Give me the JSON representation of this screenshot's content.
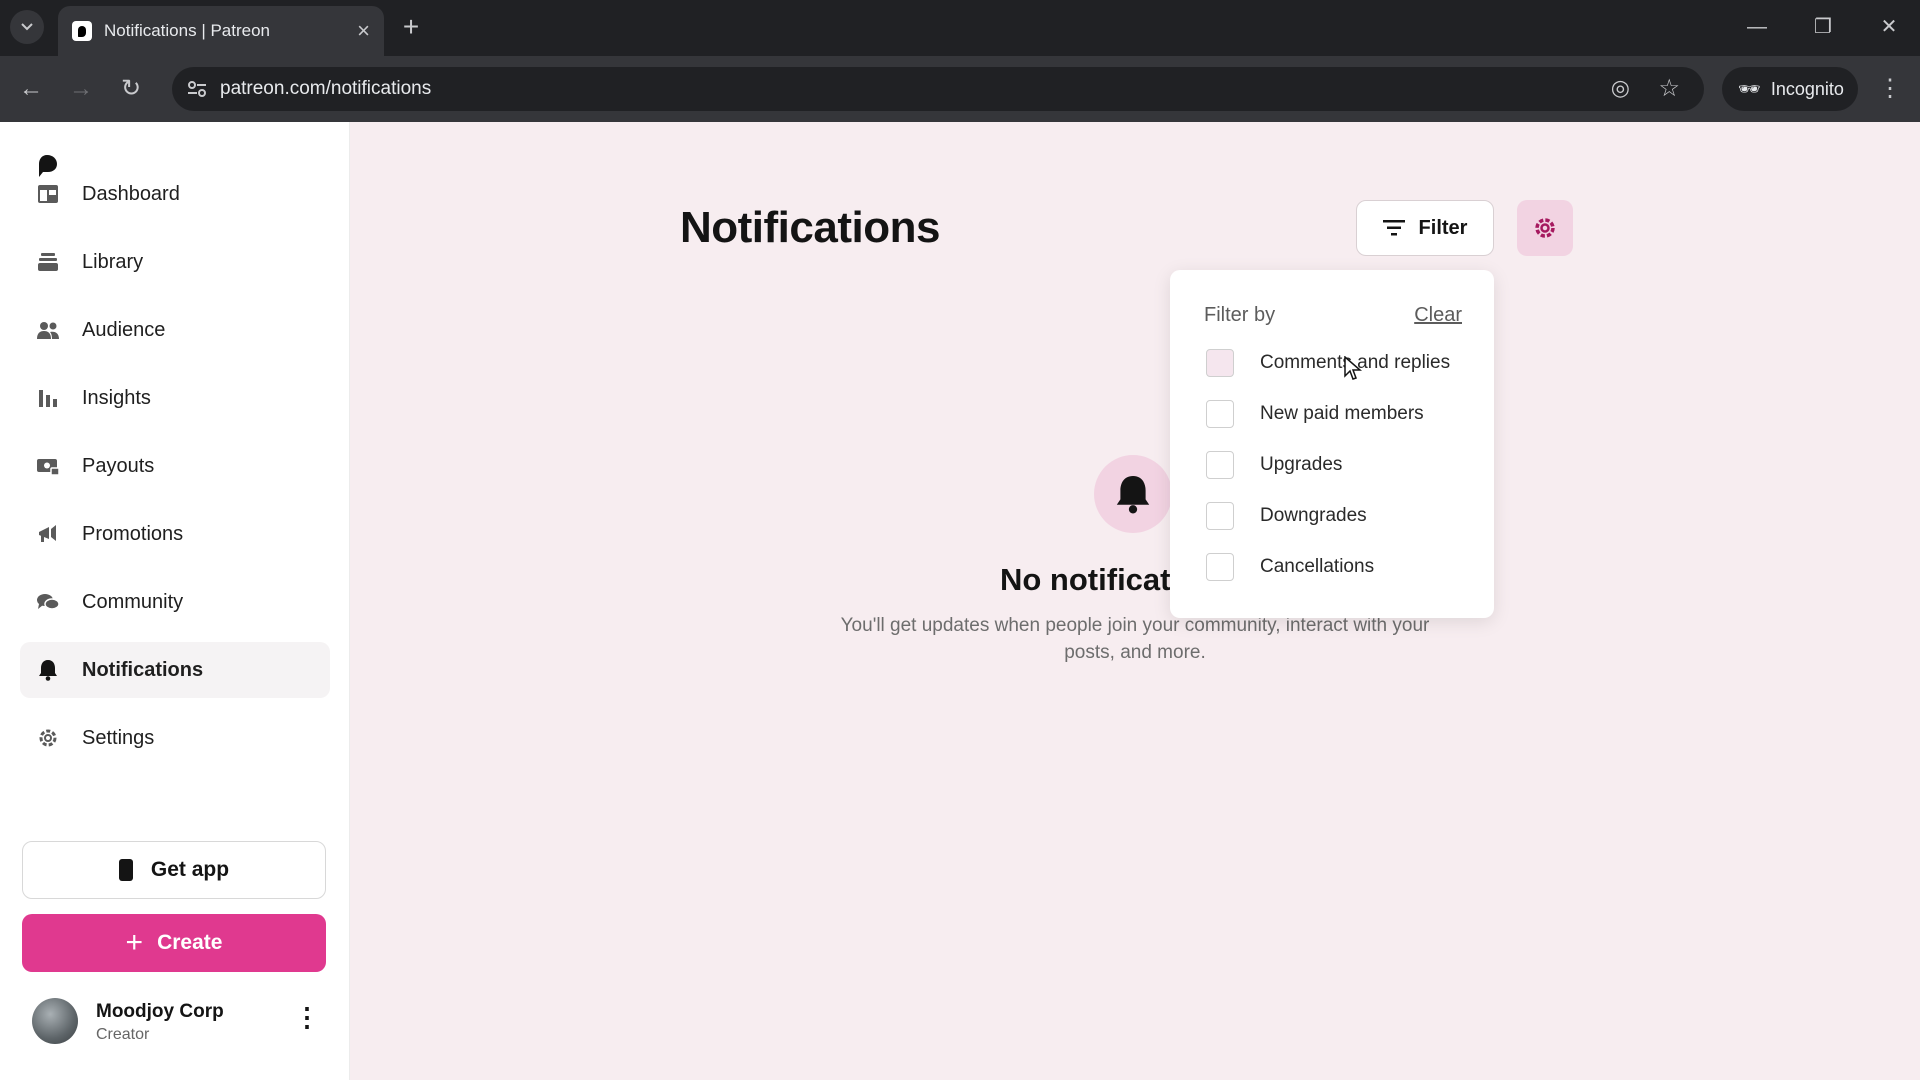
{
  "browser": {
    "tab_title": "Notifications | Patreon",
    "url": "patreon.com/notifications",
    "incognito_label": "Incognito"
  },
  "sidebar": {
    "items": [
      {
        "label": "Dashboard",
        "icon": "dashboard-icon"
      },
      {
        "label": "Library",
        "icon": "library-icon"
      },
      {
        "label": "Audience",
        "icon": "audience-icon"
      },
      {
        "label": "Insights",
        "icon": "insights-icon"
      },
      {
        "label": "Payouts",
        "icon": "payouts-icon"
      },
      {
        "label": "Promotions",
        "icon": "megaphone-icon"
      },
      {
        "label": "Community",
        "icon": "chat-bubbles-icon"
      },
      {
        "label": "Notifications",
        "icon": "bell-icon",
        "active": true
      },
      {
        "label": "Settings",
        "icon": "gear-icon"
      }
    ],
    "get_app_label": "Get app",
    "create_label": "Create",
    "profile": {
      "name": "Moodjoy Corp",
      "role": "Creator"
    }
  },
  "main": {
    "title": "Notifications",
    "filter_label": "Filter",
    "empty_title": "No notificati",
    "empty_description": "You'll get updates when people join your community, interact with your posts, and more."
  },
  "filter_menu": {
    "heading": "Filter by",
    "clear_label": "Clear",
    "options": [
      {
        "label": "Comments and replies",
        "checked": false
      },
      {
        "label": "New paid members",
        "checked": false
      },
      {
        "label": "Upgrades",
        "checked": false
      },
      {
        "label": "Downgrades",
        "checked": false
      },
      {
        "label": "Cancellations",
        "checked": false
      }
    ]
  },
  "colors": {
    "accent": "#e0398f",
    "accent_soft": "#f2d3e2",
    "page_background": "#f7edf0"
  }
}
